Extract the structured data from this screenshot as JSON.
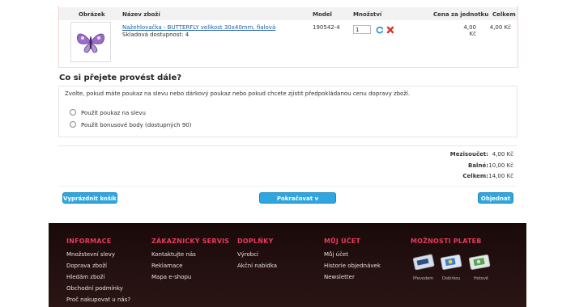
{
  "cart": {
    "headers": {
      "image": "Obrázek",
      "name": "Název zboží",
      "model": "Model",
      "quantity": "Množství",
      "unit_price": "Cena za jednotku",
      "total": "Celkem"
    },
    "item": {
      "name": "Nažehlovačka - BUTTERFLY velikost 30x40mm, fialová",
      "stock": "Skladová dostupnost: 4",
      "model": "190542-4",
      "quantity": "1",
      "unit_price": "4,00 Kč",
      "total": "4,00 Kč"
    }
  },
  "next_step": {
    "title": "Co si přejete provést dále?",
    "description": "Zvolte, pokud máte poukaz na slevu nebo dárkový poukaz nebo pokud chcete zjistit předpokládanou cenu dopravy zboží.",
    "options": [
      "Použít poukaz na slevu",
      "Použít bonusové body (dostupných 90)"
    ]
  },
  "totals": {
    "subtotal_label": "Mezisoučet:",
    "subtotal_value": "4,00 Kč",
    "packing_label": "Balné:",
    "packing_value": "10,00 Kč",
    "total_label": "Celkem:",
    "total_value": "14,00 Kč"
  },
  "buttons": {
    "empty_cart": "Vyprázdnit košík",
    "continue": "Pokračovat v nakupování",
    "order": "Objednat"
  },
  "footer": {
    "columns": [
      {
        "title": "INFORMACE",
        "links": [
          "Množstevní slevy",
          "Doprava zboží",
          "Hledám zboží",
          "Obchodní podmínky",
          "Proč nakupovat u nás?"
        ]
      },
      {
        "title": "ZÁKAZNICKÝ SERVIS",
        "links": [
          "Kontaktujte nás",
          "Reklamace",
          "Mapa e-shopu"
        ]
      },
      {
        "title": "DOPLŇKY",
        "links": [
          "Výrobci",
          "Akční nabídka"
        ]
      },
      {
        "title": "MŮJ ÚČET",
        "links": [
          "Můj účet",
          "Historie objednávek",
          "Newsletter"
        ]
      },
      {
        "title": "MOŽNOSTI PLATEB",
        "links": []
      }
    ],
    "payments": [
      "Převodem",
      "Dobírkou",
      "Hotově"
    ]
  },
  "colors": {
    "button_blue": "#2fa6df",
    "footer_title_red": "#e83a5b",
    "remove_red": "#d9302c",
    "refresh_blue": "#2b8fd6",
    "butterfly_purple": "#8e5bb5"
  },
  "icons": {
    "refresh": "refresh-icon",
    "remove": "remove-icon",
    "product": "butterfly-image"
  }
}
